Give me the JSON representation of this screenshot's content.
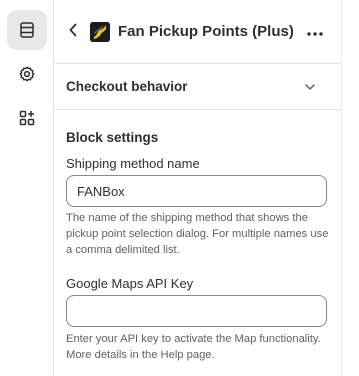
{
  "header": {
    "title": "Fan Pickup Points (Plus)"
  },
  "rail": {
    "items": [
      {
        "icon": "sections-icon",
        "active": true
      },
      {
        "icon": "gear-icon",
        "active": false
      },
      {
        "icon": "apps-icon",
        "active": false
      }
    ]
  },
  "checkout_section": {
    "title": "Checkout behavior"
  },
  "block_settings": {
    "title": "Block settings",
    "shipping_method": {
      "label": "Shipping method name",
      "value": "FANBox",
      "help": "The name of the shipping method that shows the pickup point selection dialog. For multiple names use a comma delimited list."
    },
    "google_maps": {
      "label": "Google Maps API Key",
      "value": "",
      "help": "Enter your API key to activate the Map functionality. More details in the Help page."
    }
  },
  "colors": {
    "logo_yellow": "#f5c400",
    "logo_blue": "#2a6fdb",
    "text": "#303030",
    "muted": "#616161"
  }
}
